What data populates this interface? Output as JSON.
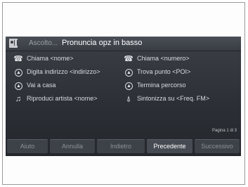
{
  "header": {
    "listening_label": "Ascolto...",
    "prompt": "Pronuncia opz in basso"
  },
  "commands": [
    {
      "icon": "phone-icon",
      "label": "Chiama <nome>"
    },
    {
      "icon": "phone-icon",
      "label": "Chiama <numero>"
    },
    {
      "icon": "navigation-icon",
      "label": "Digita indirizzo <indirizzo>"
    },
    {
      "icon": "navigation-icon",
      "label": "Trova punto <POI>"
    },
    {
      "icon": "navigation-icon",
      "label": "Vai a casa"
    },
    {
      "icon": "navigation-icon",
      "label": "Termina percorso"
    },
    {
      "icon": "music-note-icon",
      "label": "Riproduci artista <nome>"
    },
    {
      "icon": "radio-antenna-icon",
      "label": "Sintonizza su <Freq. FM>"
    }
  ],
  "page_indicator": "Pagina 1 di 3",
  "buttons": {
    "help": "Aiuto",
    "cancel": "Annulla",
    "back": "Indietro",
    "previous": "Precedente",
    "next": "Successivo"
  },
  "colors": {
    "screen_background": "#2b2f35",
    "active_button_text": "#ffffff",
    "inactive_button_text": "#8d939b"
  }
}
